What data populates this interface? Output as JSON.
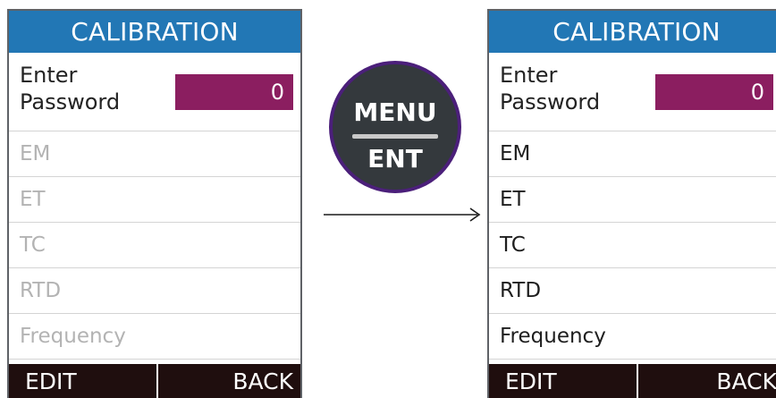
{
  "left_screen": {
    "title": "CALIBRATION",
    "password": {
      "label_line1": "Enter",
      "label_line2": "Password",
      "value": "0"
    },
    "items": [
      {
        "label": "EM"
      },
      {
        "label": "ET"
      },
      {
        "label": "TC"
      },
      {
        "label": "RTD"
      },
      {
        "label": "Frequency"
      }
    ],
    "footer": {
      "edit_label": "EDIT",
      "back_label": "BACK"
    }
  },
  "menu_button": {
    "top_label": "MENU",
    "bottom_label": "ENT"
  },
  "right_screen": {
    "title": "CALIBRATION",
    "password": {
      "label_line1": "Enter",
      "label_line2": "Password",
      "value": "0"
    },
    "items": [
      {
        "label": "EM"
      },
      {
        "label": "ET"
      },
      {
        "label": "TC"
      },
      {
        "label": "RTD"
      },
      {
        "label": "Frequency"
      }
    ],
    "footer": {
      "edit_label": "EDIT",
      "back_label": "BACK"
    }
  },
  "colors": {
    "header": "#2277b5",
    "password_field": "#8b1e60",
    "footer": "#1f0e0e",
    "disabled_text": "#b3b3b3",
    "enabled_text": "#1e1e1e",
    "button_body": "#34393d",
    "button_ring": "#4b1f7a"
  },
  "icons": {
    "transition": "right-arrow-icon"
  }
}
